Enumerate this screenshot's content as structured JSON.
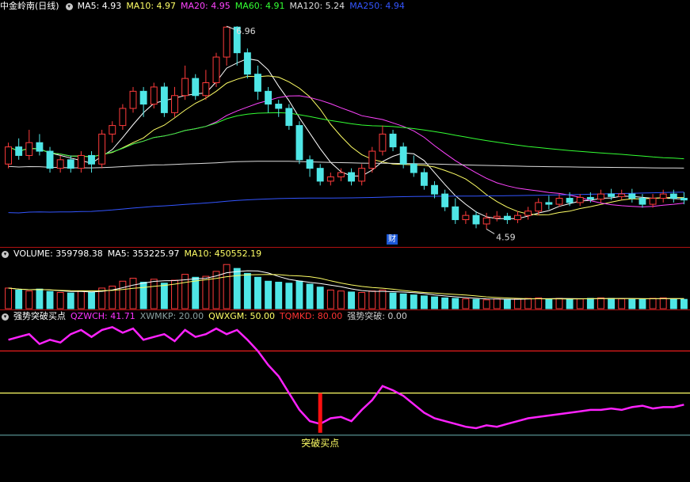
{
  "main_panel": {
    "title": "中金岭南(日线)",
    "indicators": [
      {
        "label": "MA5: 4.93",
        "color": "#ffffff"
      },
      {
        "label": "MA10: 4.97",
        "color": "#ffff66"
      },
      {
        "label": "MA20: 4.95",
        "color": "#ff44ff"
      },
      {
        "label": "MA60: 4.91",
        "color": "#33ff33"
      },
      {
        "label": "MA120: 5.24",
        "color": "#dddddd"
      },
      {
        "label": "MA250: 4.94",
        "color": "#3355ff"
      }
    ],
    "high_label": "6.96",
    "low_label": "4.59",
    "event_badge": "财"
  },
  "volume_panel": {
    "indicators": [
      {
        "label": "VOLUME: 359798.38",
        "color": "#ffffff"
      },
      {
        "label": "MA5: 353225.97",
        "color": "#ffffff"
      },
      {
        "label": "MA10: 450552.19",
        "color": "#ffff66"
      }
    ]
  },
  "indicator_panel": {
    "title": "强势突破买点",
    "indicators": [
      {
        "label": "QZWCH: 41.71",
        "color": "#ff33ff"
      },
      {
        "label": "XWMKP: 20.00",
        "color": "#8aa0a0"
      },
      {
        "label": "QWXGM: 50.00",
        "color": "#ffff66"
      },
      {
        "label": "TQMKD: 80.00",
        "color": "#ff3333"
      },
      {
        "label": "强势突破: 0.00",
        "color": "#cccccc"
      }
    ],
    "signal_label": "突破买点"
  },
  "chart_data": {
    "type": "candlestick",
    "price_range": [
      4.4,
      7.1
    ],
    "candles": [
      [
        5.35,
        5.55,
        5.3,
        5.6
      ],
      [
        5.55,
        5.45,
        5.4,
        5.65
      ],
      [
        5.45,
        5.6,
        5.4,
        5.75
      ],
      [
        5.6,
        5.5,
        5.45,
        5.7
      ],
      [
        5.5,
        5.3,
        5.25,
        5.55
      ],
      [
        5.3,
        5.4,
        5.25,
        5.45
      ],
      [
        5.4,
        5.3,
        5.25,
        5.45
      ],
      [
        5.3,
        5.45,
        5.25,
        5.5
      ],
      [
        5.45,
        5.35,
        5.25,
        5.5
      ],
      [
        5.35,
        5.7,
        5.3,
        5.75
      ],
      [
        5.7,
        5.8,
        5.6,
        5.85
      ],
      [
        5.8,
        6.0,
        5.75,
        6.05
      ],
      [
        6.0,
        6.2,
        5.95,
        6.25
      ],
      [
        6.2,
        6.05,
        5.9,
        6.25
      ],
      [
        6.05,
        6.25,
        6.0,
        6.3
      ],
      [
        6.25,
        5.95,
        5.9,
        6.3
      ],
      [
        5.95,
        6.15,
        5.9,
        6.25
      ],
      [
        6.15,
        6.35,
        6.1,
        6.5
      ],
      [
        6.35,
        6.15,
        6.1,
        6.4
      ],
      [
        6.15,
        6.3,
        6.1,
        6.45
      ],
      [
        6.3,
        6.6,
        6.25,
        6.65
      ],
      [
        6.6,
        6.95,
        6.5,
        6.96
      ],
      [
        6.95,
        6.65,
        6.5,
        6.96
      ],
      [
        6.65,
        6.4,
        6.35,
        6.7
      ],
      [
        6.4,
        6.2,
        6.1,
        6.5
      ],
      [
        6.2,
        6.05,
        5.95,
        6.25
      ],
      [
        6.05,
        6.0,
        5.9,
        6.1
      ],
      [
        6.0,
        5.8,
        5.75,
        6.05
      ],
      [
        5.8,
        5.4,
        5.35,
        5.85
      ],
      [
        5.4,
        5.3,
        5.2,
        5.45
      ],
      [
        5.3,
        5.15,
        5.1,
        5.35
      ],
      [
        5.15,
        5.2,
        5.1,
        5.25
      ],
      [
        5.2,
        5.25,
        5.15,
        5.3
      ],
      [
        5.25,
        5.15,
        5.1,
        5.3
      ],
      [
        5.15,
        5.3,
        5.1,
        5.35
      ],
      [
        5.3,
        5.5,
        5.25,
        5.55
      ],
      [
        5.5,
        5.7,
        5.45,
        5.8
      ],
      [
        5.7,
        5.55,
        5.5,
        5.75
      ],
      [
        5.55,
        5.35,
        5.3,
        5.6
      ],
      [
        5.35,
        5.25,
        5.2,
        5.45
      ],
      [
        5.25,
        5.1,
        5.05,
        5.3
      ],
      [
        5.1,
        5.0,
        4.95,
        5.15
      ],
      [
        5.0,
        4.85,
        4.8,
        5.05
      ],
      [
        4.85,
        4.7,
        4.65,
        4.95
      ],
      [
        4.7,
        4.75,
        4.65,
        4.8
      ],
      [
        4.75,
        4.65,
        4.6,
        4.8
      ],
      [
        4.65,
        4.72,
        4.59,
        4.78
      ],
      [
        4.72,
        4.74,
        4.68,
        4.8
      ],
      [
        4.74,
        4.7,
        4.65,
        4.78
      ],
      [
        4.7,
        4.75,
        4.66,
        4.8
      ],
      [
        4.75,
        4.8,
        4.7,
        4.85
      ],
      [
        4.8,
        4.9,
        4.75,
        4.95
      ],
      [
        4.9,
        4.88,
        4.82,
        4.98
      ],
      [
        4.88,
        4.95,
        4.85,
        5.0
      ],
      [
        4.95,
        4.9,
        4.86,
        5.02
      ],
      [
        4.9,
        4.96,
        4.86,
        5.0
      ],
      [
        4.96,
        4.94,
        4.9,
        5.02
      ],
      [
        4.94,
        5.0,
        4.9,
        5.05
      ],
      [
        5.0,
        4.97,
        4.93,
        5.06
      ],
      [
        4.97,
        5.0,
        4.93,
        5.05
      ],
      [
        5.0,
        4.95,
        4.9,
        5.06
      ],
      [
        4.95,
        4.88,
        4.84,
        5.0
      ],
      [
        4.88,
        4.95,
        4.84,
        5.0
      ],
      [
        4.95,
        5.0,
        4.9,
        5.05
      ],
      [
        5.0,
        4.95,
        4.9,
        5.05
      ],
      [
        4.95,
        4.93,
        4.88,
        5.02
      ]
    ],
    "volume_max": 1000000,
    "volumes": [
      420000,
      380000,
      360000,
      400000,
      350000,
      330000,
      320000,
      360000,
      340000,
      420000,
      460000,
      560000,
      620000,
      540000,
      600000,
      520000,
      580000,
      700000,
      640000,
      660000,
      760000,
      900000,
      820000,
      720000,
      640000,
      560000,
      540000,
      520000,
      560000,
      500000,
      440000,
      380000,
      360000,
      340000,
      330000,
      360000,
      380000,
      320000,
      300000,
      280000,
      260000,
      240000,
      220000,
      210000,
      200000,
      190000,
      180000,
      200000,
      190000,
      200000,
      210000,
      220000,
      200000,
      210000,
      190000,
      200000,
      210000,
      220000,
      210000,
      200000,
      190000,
      200000,
      210000,
      220000,
      200000,
      190000
    ],
    "indicator_range": [
      -10,
      100
    ],
    "qzwch": [
      88,
      90,
      92,
      85,
      88,
      86,
      92,
      95,
      90,
      95,
      97,
      93,
      96,
      88,
      90,
      92,
      87,
      95,
      90,
      92,
      96,
      92,
      95,
      88,
      80,
      70,
      62,
      50,
      38,
      30,
      28,
      32,
      33,
      30,
      38,
      45,
      55,
      52,
      48,
      42,
      36,
      32,
      30,
      28,
      26,
      25,
      27,
      26,
      28,
      30,
      32,
      33,
      34,
      35,
      36,
      37,
      38,
      38,
      39,
      38,
      40,
      41,
      39,
      40,
      40,
      41.71
    ],
    "levels": {
      "TQMKD": 80,
      "QWXGM": 50,
      "XWMKP": 20
    },
    "signal_index": 30
  }
}
